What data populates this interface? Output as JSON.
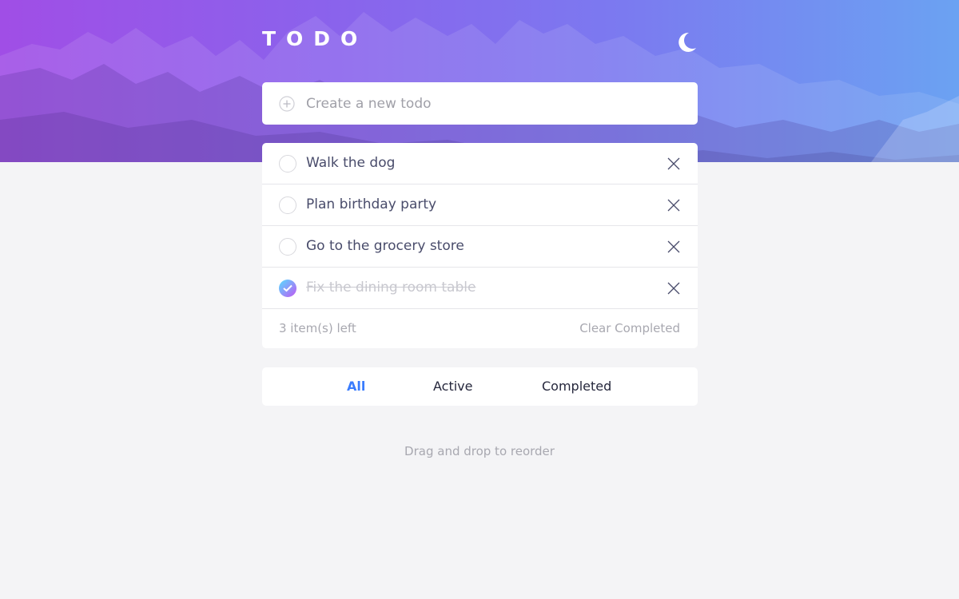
{
  "app": {
    "title": "TODO",
    "theme_icon": "moon-icon",
    "accent_color": "#3a7cfd",
    "check_gradient": [
      "#57ddff",
      "#c058f3"
    ]
  },
  "new_todo": {
    "placeholder": "Create a new todo",
    "icon": "plus-circle-icon"
  },
  "todos": [
    {
      "text": "Walk the dog",
      "completed": false
    },
    {
      "text": "Plan birthday party",
      "completed": false
    },
    {
      "text": "Go to the grocery store",
      "completed": false
    },
    {
      "text": "Fix the dining room table",
      "completed": true
    }
  ],
  "footer": {
    "items_left": "3 item(s) left",
    "clear_label": "Clear Completed"
  },
  "filters": {
    "all": "All",
    "active": "Active",
    "completed": "Completed",
    "selected": "All"
  },
  "hint": "Drag and drop to reorder"
}
